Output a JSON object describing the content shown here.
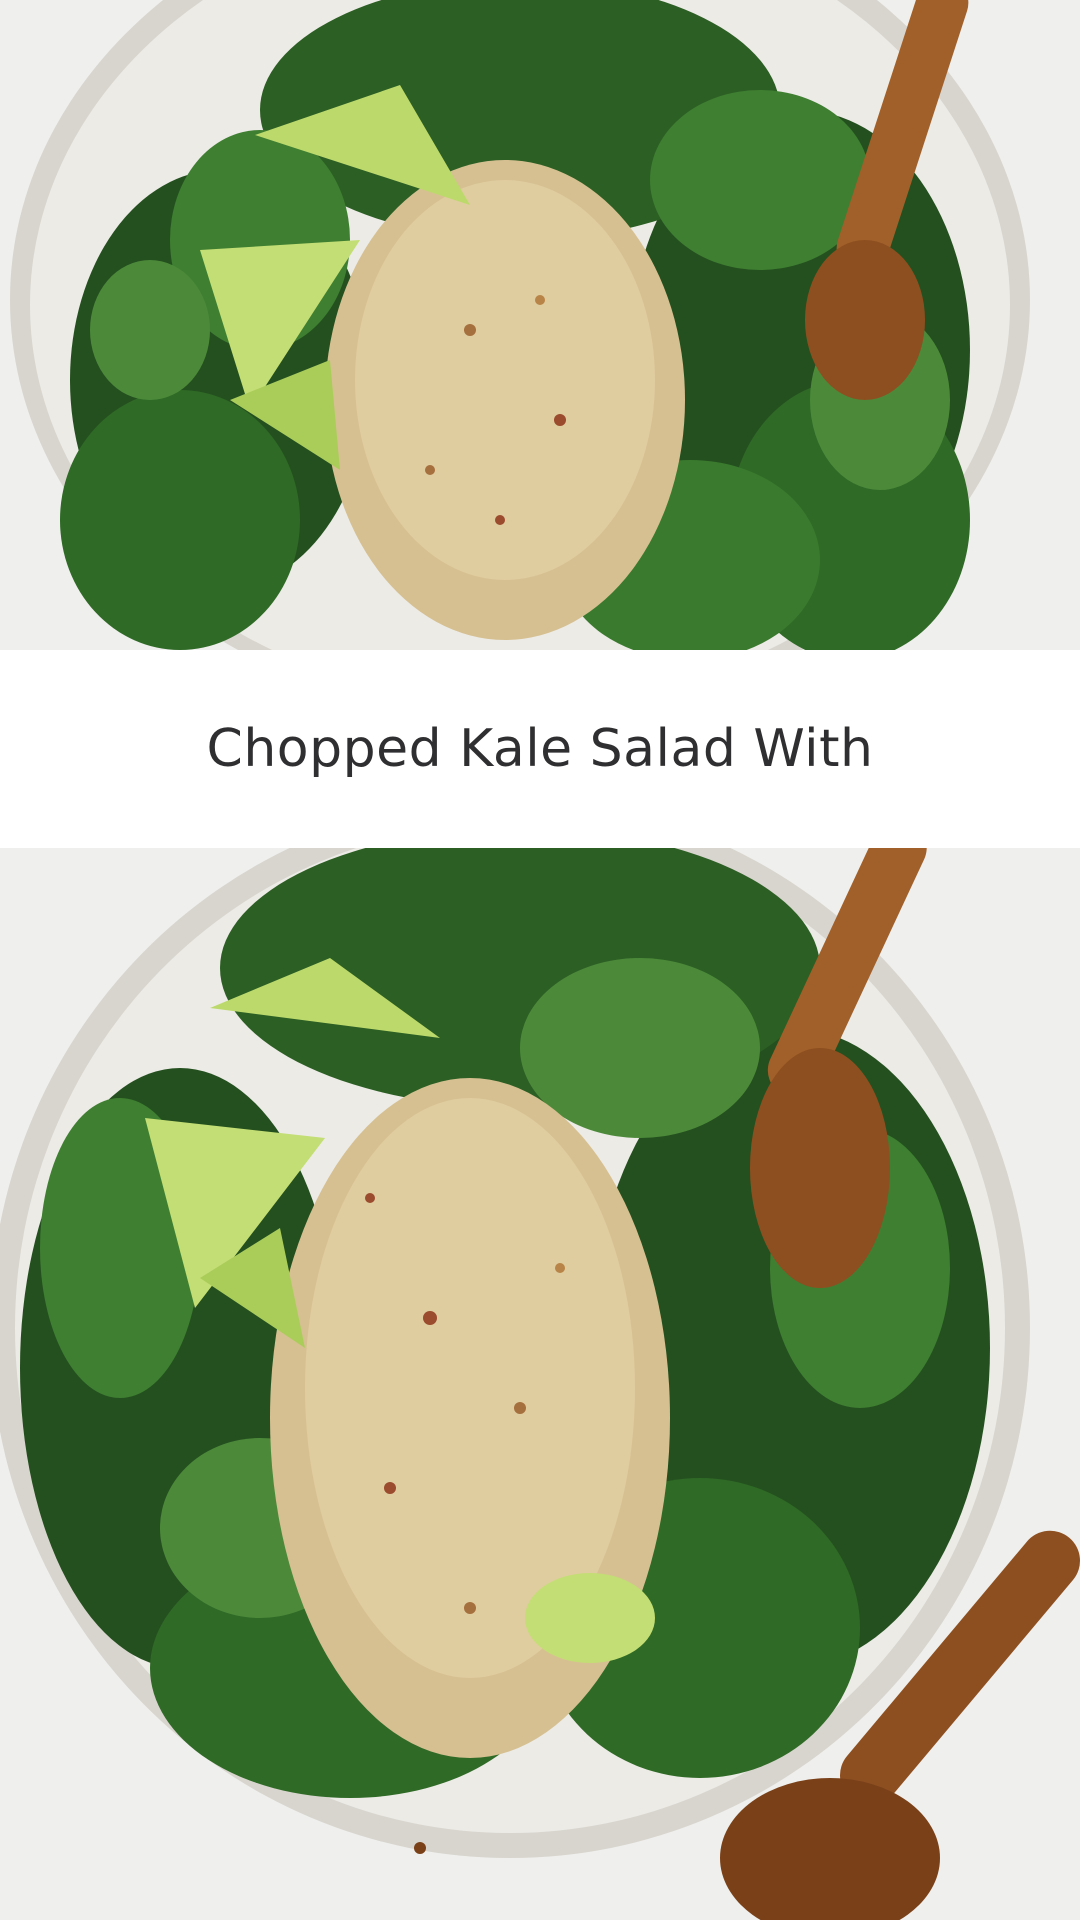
{
  "pin": {
    "title": "Chopped Kale Salad With",
    "colors": {
      "background": "#eeeeec",
      "bowl_rim": "#d9d6cf",
      "bowl_inner": "#efeee9",
      "kale_dark": "#1f4a1e",
      "kale_mid": "#2f6a26",
      "kale_light": "#4c8a3a",
      "quinoa": "#d9c49a",
      "quinoa_dark": "#a5703e",
      "lime": "#b9d96a",
      "lime_light": "#dcef9c",
      "wood": "#a1602a",
      "wood_dark": "#7a4119"
    }
  },
  "images": {
    "top": "salad-bowl-photo",
    "bottom": "salad-bowl-photo"
  }
}
